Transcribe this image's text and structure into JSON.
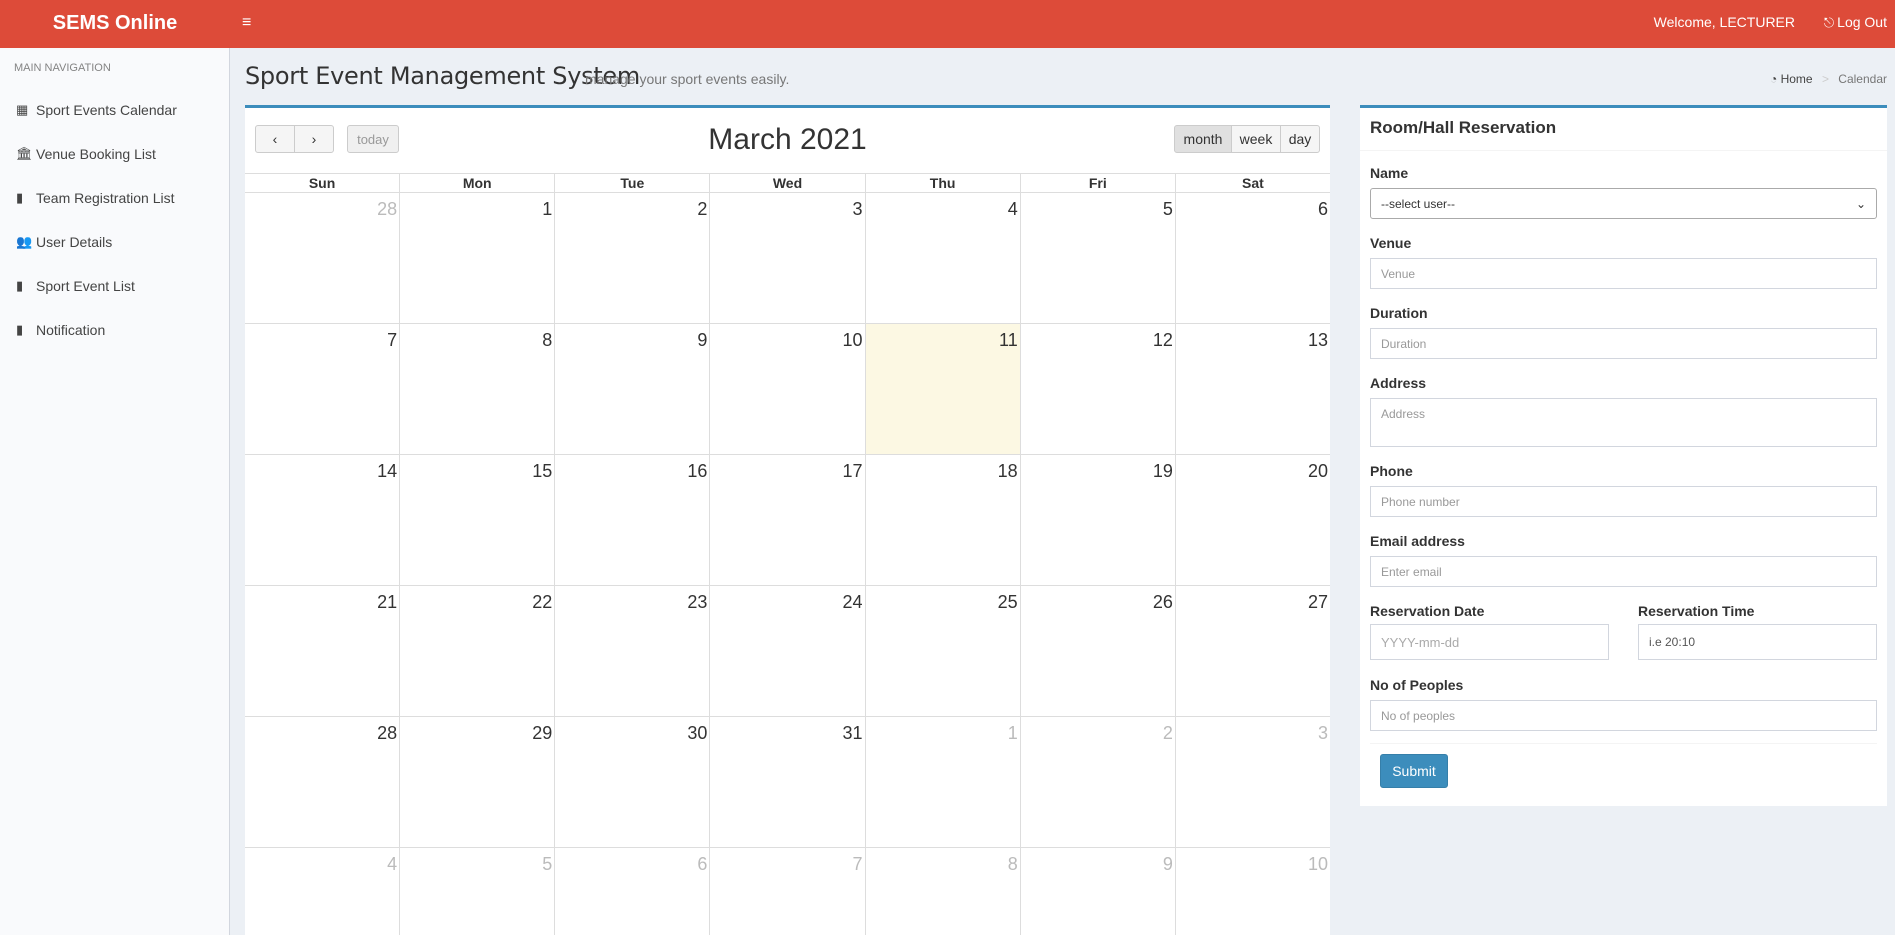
{
  "header": {
    "logo": "SEMS Online",
    "menu_icon": "≡",
    "welcome": "Welcome, LECTURER",
    "logout": "Log Out"
  },
  "sidebar": {
    "header": "MAIN NAVIGATION",
    "items": [
      {
        "label": "Sport Events Calendar",
        "icon": "calendar-icon",
        "glyph": "▦"
      },
      {
        "label": "Venue Booking List",
        "icon": "bank-icon",
        "glyph": "🏛"
      },
      {
        "label": "Team Registration List",
        "icon": "book-icon",
        "glyph": "▮"
      },
      {
        "label": "User Details",
        "icon": "users-icon",
        "glyph": "👥"
      },
      {
        "label": "Sport Event List",
        "icon": "book-icon",
        "glyph": "▮"
      },
      {
        "label": "Notification",
        "icon": "book-icon",
        "glyph": "▮"
      }
    ]
  },
  "content_header": {
    "title": "Sport Event Management System",
    "subtitle": "manage your sport events easily.",
    "breadcrumb": {
      "home": "Home",
      "current": "Calendar"
    }
  },
  "calendar": {
    "title": "March 2021",
    "prev": "‹",
    "next": "›",
    "today": "today",
    "views": {
      "month": "month",
      "week": "week",
      "day": "day"
    },
    "days_of_week": [
      "Sun",
      "Mon",
      "Tue",
      "Wed",
      "Thu",
      "Fri",
      "Sat"
    ],
    "weeks": [
      [
        {
          "d": "28",
          "o": true
        },
        {
          "d": "1"
        },
        {
          "d": "2"
        },
        {
          "d": "3"
        },
        {
          "d": "4"
        },
        {
          "d": "5"
        },
        {
          "d": "6"
        }
      ],
      [
        {
          "d": "7"
        },
        {
          "d": "8"
        },
        {
          "d": "9"
        },
        {
          "d": "10"
        },
        {
          "d": "11",
          "t": true
        },
        {
          "d": "12"
        },
        {
          "d": "13"
        }
      ],
      [
        {
          "d": "14"
        },
        {
          "d": "15"
        },
        {
          "d": "16"
        },
        {
          "d": "17"
        },
        {
          "d": "18"
        },
        {
          "d": "19"
        },
        {
          "d": "20"
        }
      ],
      [
        {
          "d": "21"
        },
        {
          "d": "22"
        },
        {
          "d": "23"
        },
        {
          "d": "24"
        },
        {
          "d": "25"
        },
        {
          "d": "26"
        },
        {
          "d": "27"
        }
      ],
      [
        {
          "d": "28"
        },
        {
          "d": "29"
        },
        {
          "d": "30"
        },
        {
          "d": "31"
        },
        {
          "d": "1",
          "o": true
        },
        {
          "d": "2",
          "o": true
        },
        {
          "d": "3",
          "o": true
        }
      ],
      [
        {
          "d": "4",
          "o": true
        },
        {
          "d": "5",
          "o": true
        },
        {
          "d": "6",
          "o": true
        },
        {
          "d": "7",
          "o": true
        },
        {
          "d": "8",
          "o": true
        },
        {
          "d": "9",
          "o": true
        },
        {
          "d": "10",
          "o": true
        }
      ]
    ]
  },
  "reservation": {
    "title": "Room/Hall Reservation",
    "name_label": "Name",
    "name_value": "--select user--",
    "venue_label": "Venue",
    "venue_placeholder": "Venue",
    "duration_label": "Duration",
    "duration_placeholder": "Duration",
    "address_label": "Address",
    "address_placeholder": "Address",
    "phone_label": "Phone",
    "phone_placeholder": "Phone number",
    "email_label": "Email address",
    "email_placeholder": "Enter email",
    "date_label": "Reservation Date",
    "date_placeholder": "YYYY-mm-dd",
    "time_label": "Reservation Time",
    "time_value": "i.e 20:10",
    "peoples_label": "No of Peoples",
    "peoples_placeholder": "No of peoples",
    "submit": "Submit"
  }
}
